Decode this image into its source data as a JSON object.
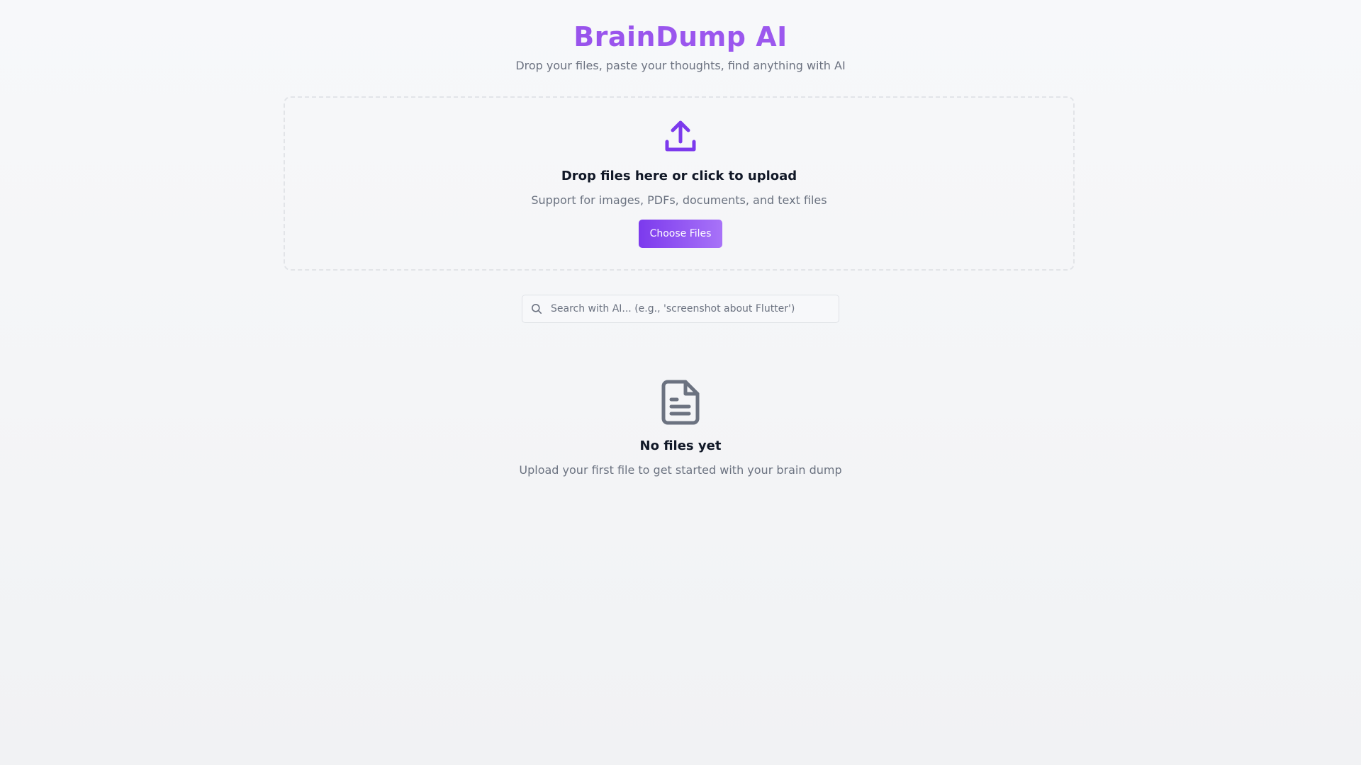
{
  "header": {
    "title": "BrainDump AI",
    "subtitle": "Drop your files, paste your thoughts, find anything with AI"
  },
  "upload": {
    "icon": "upload-icon",
    "title": "Drop files here or click to upload",
    "hint": "Support for images, PDFs, documents, and text files",
    "button_label": "Choose Files"
  },
  "search": {
    "icon": "search-icon",
    "placeholder": "Search with AI... (e.g., 'screenshot about Flutter')",
    "value": ""
  },
  "empty_state": {
    "icon": "file-text-icon",
    "title": "No files yet",
    "hint": "Upload your first file to get started with your brain dump"
  },
  "colors": {
    "accent": "#7c3aed",
    "accent_light": "#a873f8",
    "title_gradient_start": "#9146e6",
    "muted_text": "#6b7280",
    "icon_gray": "#6b7280"
  }
}
